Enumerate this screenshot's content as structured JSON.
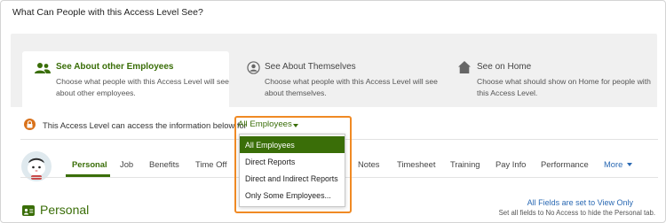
{
  "heading": "What Can People with this Access Level See?",
  "cards": [
    {
      "title": "See About other Employees",
      "desc": "Choose what people with this Access Level will see about other employees.",
      "icon": "people-icon"
    },
    {
      "title": "See About Themselves",
      "desc": "Choose what people with this Access Level will see about themselves.",
      "icon": "user-circle-icon"
    },
    {
      "title": "See on Home",
      "desc": "Choose what should show on Home for people with this Access Level.",
      "icon": "home-icon"
    }
  ],
  "access": {
    "text": "This Access Level can access the information below for",
    "selected": "All Employees",
    "options": [
      "All Employees",
      "Direct Reports",
      "Direct and Indirect Reports",
      "Only Some Employees..."
    ]
  },
  "tabs": [
    "Personal",
    "Job",
    "Benefits",
    "Time Off",
    "Notes",
    "Timesheet",
    "Training",
    "Pay Info",
    "Performance",
    "More"
  ],
  "section": {
    "title": "Personal",
    "fields_link": "All Fields are set to View Only",
    "fields_sub": "Set all fields to No Access to hide the Personal tab."
  },
  "colors": {
    "accent": "#3a6e08",
    "link": "#2a69b3",
    "highlight": "#f08a24"
  }
}
